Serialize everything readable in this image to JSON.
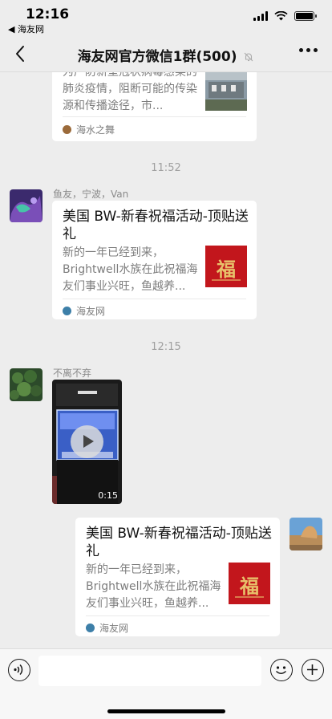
{
  "status_bar": {
    "time": "12:16",
    "back_app": "◀ 海友网"
  },
  "nav": {
    "title": "海友网官方微信1群(500)"
  },
  "messages": {
    "card1": {
      "desc": "为产防新型冠状病毒感染的肺炎疫情，阻断可能的传染源和传播途径，市...",
      "source": "海水之舞"
    },
    "time1": "11:52",
    "msg2": {
      "sender": "鱼友，宁波，Van",
      "title": "美国 BW-新春祝福活动-顶贴送礼",
      "desc": "新的一年已经到来，Brightwell水族在此祝福海友们事业兴旺，鱼越养...",
      "thumb_text": "福",
      "source": "海友网"
    },
    "time2": "12:15",
    "msg3": {
      "sender": "不离不弃",
      "duration": "0:15"
    },
    "msg4": {
      "title": "美国 BW-新春祝福活动-顶贴送礼",
      "desc": "新的一年已经到来，Brightwell水族在此祝福海友们事业兴旺，鱼越养...",
      "thumb_text": "福",
      "source": "海友网"
    }
  },
  "icons": {
    "back": "chevron-left-icon",
    "mute": "bell-off-icon",
    "more": "more-icon",
    "voice": "voice-icon",
    "emoji": "emoji-icon",
    "add": "plus-icon"
  },
  "colors": {
    "background": "#ededed",
    "card": "#ffffff",
    "red_thumb": "#c2161c",
    "gold": "#e8c06a"
  }
}
